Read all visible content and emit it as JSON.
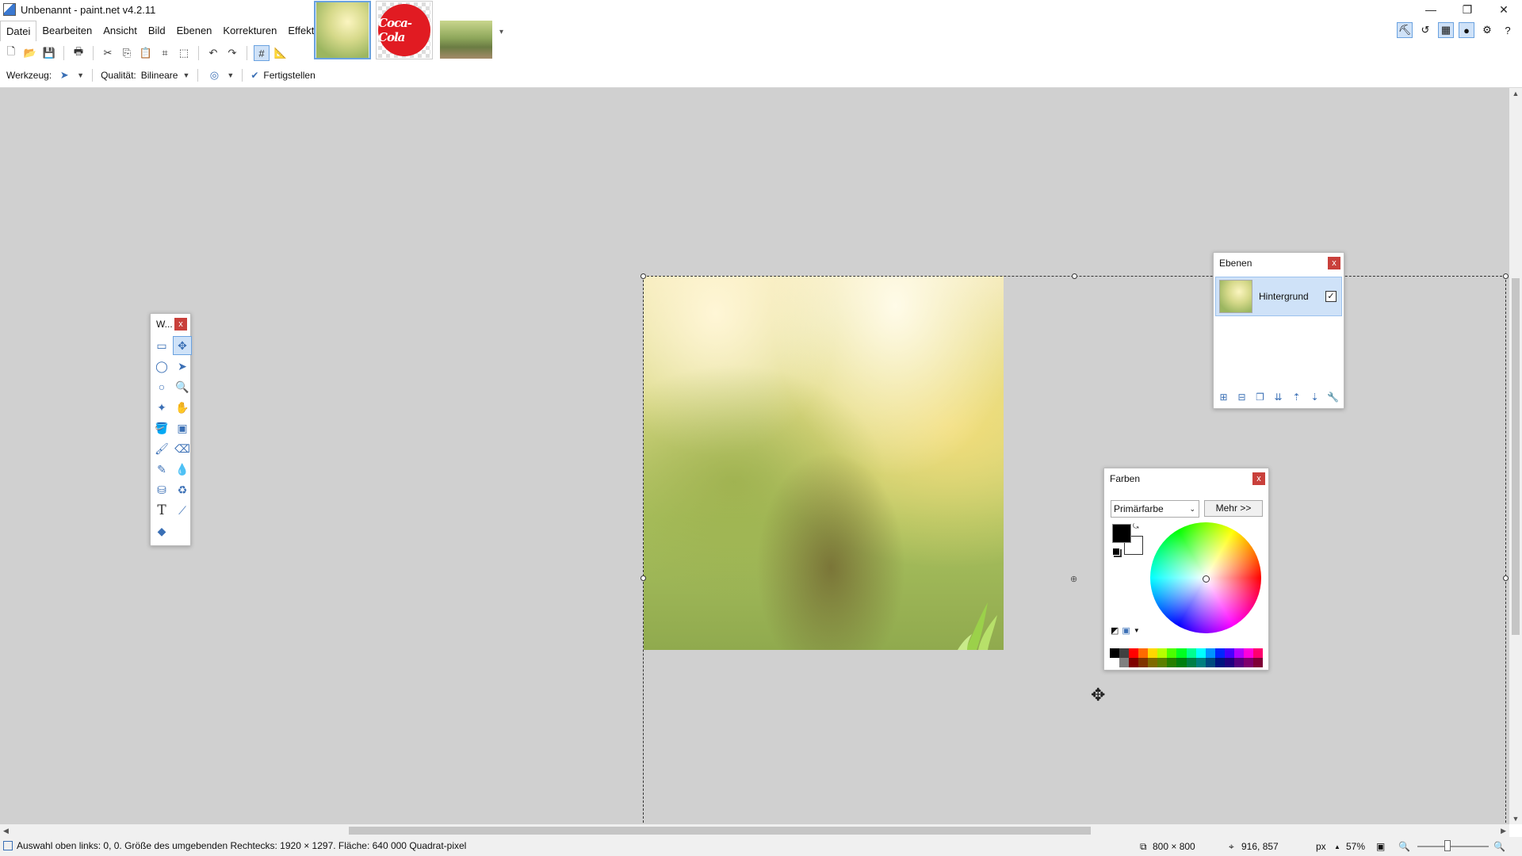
{
  "window": {
    "title": "Unbenannt - paint.net v4.2.11",
    "minimize": "—",
    "maximize": "❐",
    "close": "✕"
  },
  "menu": [
    "Datei",
    "Bearbeiten",
    "Ansicht",
    "Bild",
    "Ebenen",
    "Korrekturen",
    "Effekte"
  ],
  "thumbnails": {
    "coke_text": "Coca-Cola",
    "more": "▾"
  },
  "options": {
    "tool_label": "Werkzeug:",
    "quality_label": "Qualität:",
    "quality_value": "Bilineare",
    "finish_label": "Fertigstellen"
  },
  "tools_window": {
    "title": "W..."
  },
  "layers_window": {
    "title": "Ebenen",
    "layer_name": "Hintergrund"
  },
  "colors_window": {
    "title": "Farben",
    "mode": "Primärfarbe",
    "more_button": "Mehr >>",
    "primary_color": "#000000",
    "secondary_color": "#ffffff"
  },
  "palette": {
    "row1": [
      "#000000",
      "#404040",
      "#ff0000",
      "#ff6a00",
      "#ffd800",
      "#b6ff00",
      "#4cff00",
      "#00ff21",
      "#00ff90",
      "#00ffff",
      "#0094ff",
      "#0026ff",
      "#4800ff",
      "#b200ff",
      "#ff00dc",
      "#ff006e"
    ],
    "row2": [
      "#ffffff",
      "#808080",
      "#7f0000",
      "#7f3300",
      "#7f6a00",
      "#5b7f00",
      "#267f00",
      "#007f0e",
      "#007f46",
      "#007f7f",
      "#004a7f",
      "#00137f",
      "#21007f",
      "#57007f",
      "#7f006e",
      "#7f0037"
    ]
  },
  "status": {
    "selection_text": "Auswahl oben links: 0, 0. Größe des umgebenden Rechtecks: 1920 × 1297. Fläche: 640 000 Quadrat-pixel",
    "image_size": "800 × 800",
    "cursor_pos": "916, 857",
    "unit": "px",
    "zoom": "57%"
  }
}
